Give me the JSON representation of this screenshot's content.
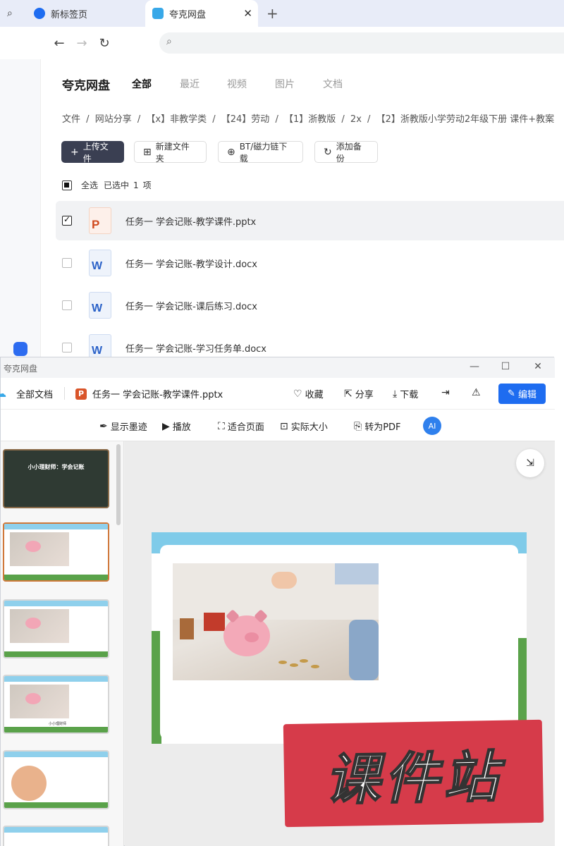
{
  "browser": {
    "tabs": [
      {
        "label": "新标签页"
      },
      {
        "label": "夸克网盘"
      }
    ]
  },
  "drive": {
    "brand": "夸克网盘",
    "categories": [
      "全部",
      "最近",
      "视频",
      "图片",
      "文档"
    ],
    "breadcrumb": [
      "文件",
      "/",
      "网站分享",
      "/",
      "【x】非教学类",
      "/",
      "【24】劳动",
      "/",
      "【1】浙教版",
      "/",
      "2x",
      "/",
      "【2】浙教版小学劳动2年级下册 课件+教案"
    ],
    "actions": {
      "upload": "上传文件",
      "new_folder": "新建文件夹",
      "bt": "BT/磁力链下载",
      "backup": "添加备份"
    },
    "selection": {
      "select_all": "全选",
      "selected_prefix": "已选中",
      "count": "1",
      "unit": "项"
    },
    "files": [
      {
        "name": "任务一 学会记账-教学课件.pptx",
        "type": "ppt",
        "checked": true
      },
      {
        "name": "任务一 学会记账-教学设计.docx",
        "type": "doc",
        "checked": false
      },
      {
        "name": "任务一 学会记账-课后练习.docx",
        "type": "doc",
        "checked": false
      },
      {
        "name": "任务一 学会记账-学习任务单.docx",
        "type": "doc",
        "checked": false
      }
    ]
  },
  "viewer": {
    "window_title": "夸克网盘",
    "all_docs": "全部文档",
    "file_name": "任务一 学会记账-教学课件.pptx",
    "favorite": "收藏",
    "share": "分享",
    "download": "下载",
    "edit": "编辑",
    "toolbar": {
      "ink": "显示墨迹",
      "play": "播放",
      "fit_page": "适合页面",
      "actual_size": "实际大小",
      "to_pdf": "转为PDF"
    },
    "thumb1_title": "小小理财师：学会记账",
    "thumb3_caption": "小小理财师",
    "watermark": "课件站"
  },
  "colors": {
    "accent": "#1e6cf0",
    "dark_button": "#3a3f52",
    "stamp": "#d63b4a"
  }
}
